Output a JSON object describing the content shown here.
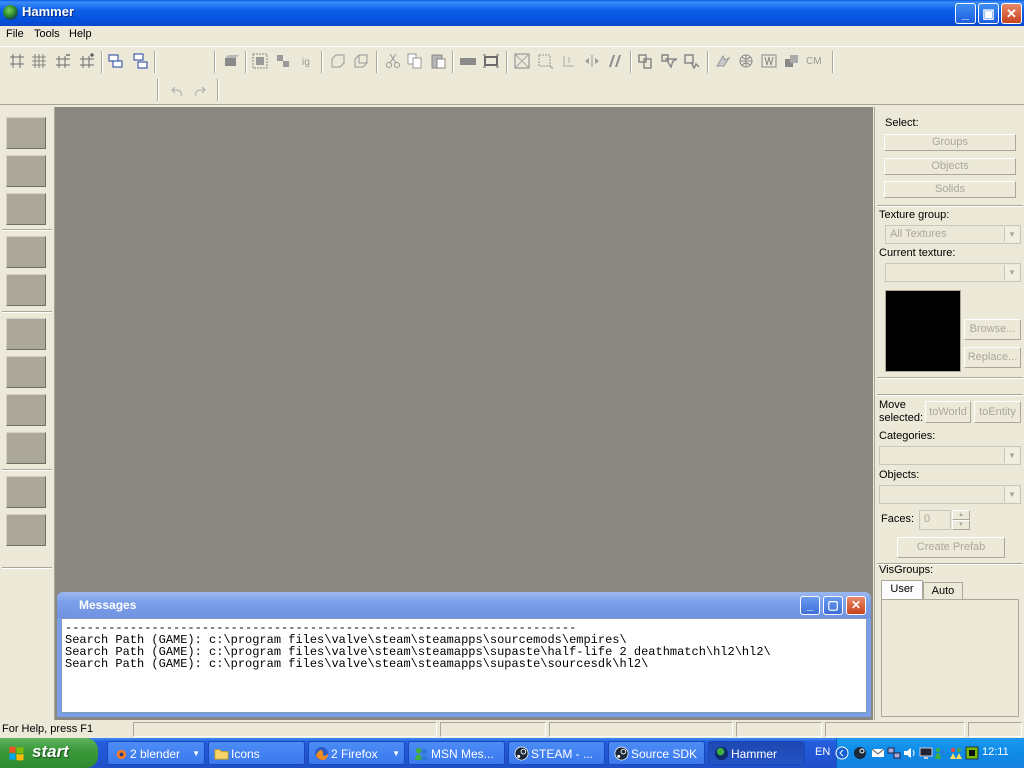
{
  "window": {
    "title": "Hammer",
    "minimize": "_",
    "restore": "▣",
    "close": "✕"
  },
  "menu": {
    "file": "File",
    "tools": "Tools",
    "help": "Help"
  },
  "toolbar": {
    "cm_label": "CM"
  },
  "messages": {
    "title": "Messages",
    "lines": [
      "-----------------------------------------------------------------------",
      "Search Path (GAME): c:\\program files\\valve\\steam\\steamapps\\sourcemods\\empires\\",
      "Search Path (GAME): c:\\program files\\valve\\steam\\steamapps\\supaste\\half-life 2 deathmatch\\hl2\\hl2\\",
      "Search Path (GAME): c:\\program files\\valve\\steam\\steamapps\\supaste\\sourcesdk\\hl2\\"
    ]
  },
  "right_panel": {
    "select_label": "Select:",
    "groups": "Groups",
    "objects": "Objects",
    "solids": "Solids",
    "texture_group_label": "Texture group:",
    "texture_group_value": "All Textures",
    "current_texture_label": "Current texture:",
    "browse": "Browse...",
    "replace": "Replace...",
    "move_selected_label_1": "Move",
    "move_selected_label_2": "selected:",
    "to_world": "toWorld",
    "to_entity": "toEntity",
    "categories_label": "Categories:",
    "objects_label": "Objects:",
    "faces_label": "Faces:",
    "faces_value": "0",
    "create_prefab": "Create Prefab",
    "visgroups_label": "VisGroups:",
    "tab_user": "User",
    "tab_auto": "Auto"
  },
  "status": {
    "help": "For Help, press F1"
  },
  "taskbar": {
    "start": "start",
    "items": [
      {
        "label": "2 blender",
        "icon": "blender-icon"
      },
      {
        "label": "Icons",
        "icon": "folder-icon"
      },
      {
        "label": "2 Firefox",
        "icon": "firefox-icon"
      },
      {
        "label": "MSN Mes...",
        "icon": "msn-icon"
      },
      {
        "label": "STEAM - ...",
        "icon": "steam-icon"
      },
      {
        "label": "Source SDK",
        "icon": "steam-icon"
      },
      {
        "label": "Hammer",
        "icon": "hammer-icon"
      }
    ],
    "lang": "EN",
    "clock": "12:11"
  },
  "colors": {
    "viewport": "#8a8680",
    "titlebar": "#0b5fe8",
    "taskbar": "#245edb",
    "start": "#3c9a3c"
  }
}
